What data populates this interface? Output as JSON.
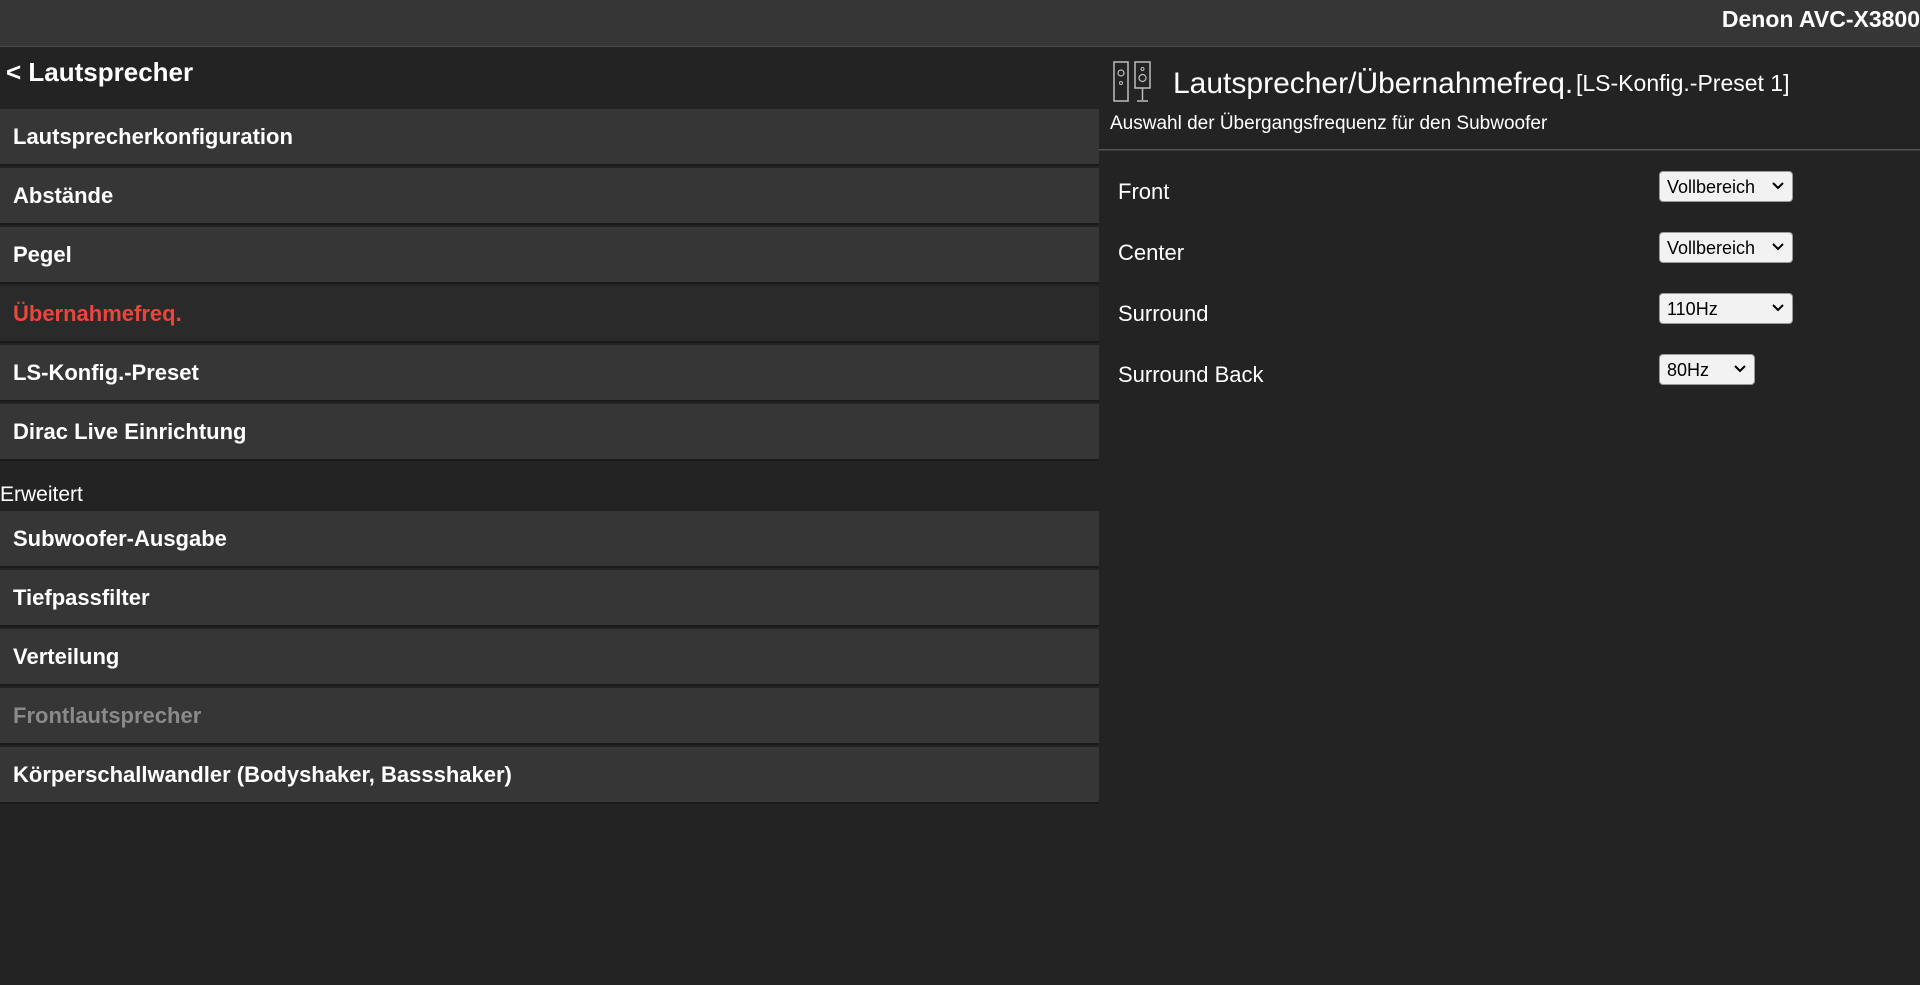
{
  "device": {
    "name": "Denon AVC-X3800"
  },
  "nav": {
    "back_label": "< Lautsprecher",
    "items": [
      {
        "label": "Lautsprecherkonfiguration"
      },
      {
        "label": "Abstände"
      },
      {
        "label": "Pegel"
      },
      {
        "label": "Übernahmefreq."
      },
      {
        "label": "LS-Konfig.-Preset"
      },
      {
        "label": "Dirac Live Einrichtung"
      }
    ],
    "section_label": "Erweitert",
    "advanced_items": [
      {
        "label": "Subwoofer-Ausgabe"
      },
      {
        "label": "Tiefpassfilter"
      },
      {
        "label": "Verteilung"
      },
      {
        "label": "Frontlautsprecher"
      },
      {
        "label": "Körperschallwandler (Bodyshaker, Bassshaker)"
      }
    ]
  },
  "page": {
    "title": "Lautsprecher/Übernahmefreq.",
    "preset": "[LS-Konfig.-Preset 1]",
    "subtitle": "Auswahl der Übergangsfrequenz für den Subwoofer",
    "settings": [
      {
        "label": "Front",
        "value": "Vollbereich"
      },
      {
        "label": "Center",
        "value": "Vollbereich"
      },
      {
        "label": "Surround",
        "value": "110Hz"
      },
      {
        "label": "Surround Back",
        "value": "80Hz"
      }
    ]
  },
  "icons": {
    "speakers": "speakers-icon",
    "chevron": "chevron-down-icon"
  },
  "colors": {
    "accent": "#e8473a",
    "background": "#232323",
    "panel": "#363636"
  }
}
